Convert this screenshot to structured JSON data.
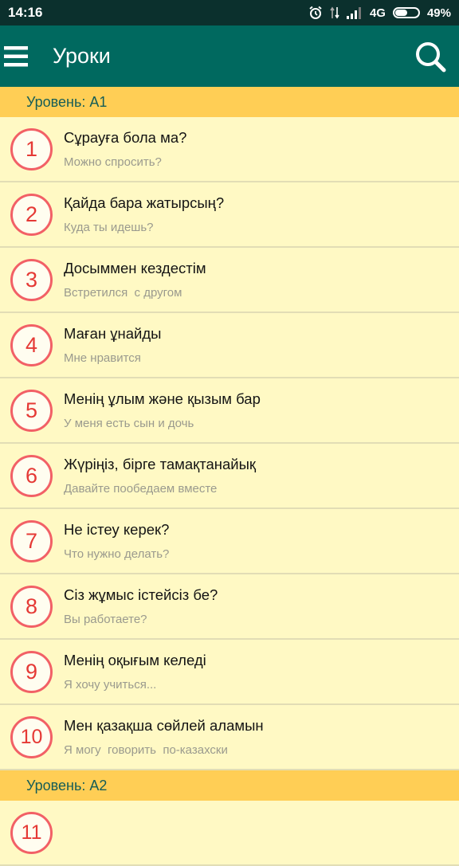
{
  "status_bar": {
    "time": "14:16",
    "network": "4G",
    "battery": "49%",
    "battery_level": 0.49
  },
  "app_bar": {
    "title": "Уроки"
  },
  "sections": [
    {
      "header": "Уровень: A1",
      "lessons": [
        {
          "number": "1",
          "title": "Сұрауға бола ма?",
          "subtitle": "Можно спросить?"
        },
        {
          "number": "2",
          "title": "Қайда бара жатырсың?",
          "subtitle": "Куда ты идешь?"
        },
        {
          "number": "3",
          "title": "Досыммен кездестім",
          "subtitle": "Встретился  с другом"
        },
        {
          "number": "4",
          "title": "Маған ұнайды",
          "subtitle": "Мне нравится"
        },
        {
          "number": "5",
          "title": "Менің ұлым және қызым бар",
          "subtitle": "У меня есть сын и дочь"
        },
        {
          "number": "6",
          "title": "Жүріңіз, бірге тамақтанайық",
          "subtitle": "Давайте пообедаем вместе"
        },
        {
          "number": "7",
          "title": "Не істеу керек?",
          "subtitle": "Что нужно делать?"
        },
        {
          "number": "8",
          "title": "Сіз жұмыс істейсіз бе?",
          "subtitle": "Вы работаете?"
        },
        {
          "number": "9",
          "title": "Менің оқығым келеді",
          "subtitle": "Я хочу учиться..."
        },
        {
          "number": "10",
          "title": "Мен қазақша сөйлей аламын",
          "subtitle": "Я могу  говорить  по-казахски"
        }
      ]
    },
    {
      "header": "Уровень: A2",
      "lessons": [
        {
          "number": "11",
          "title": "",
          "subtitle": ""
        }
      ]
    }
  ]
}
